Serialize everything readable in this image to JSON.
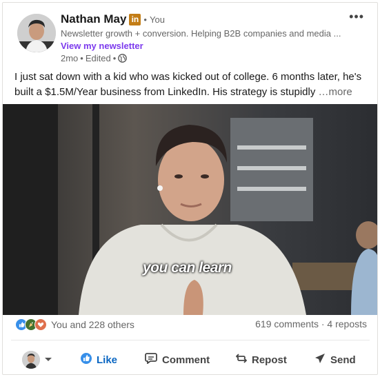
{
  "author": {
    "name": "Nathan May",
    "badge": "in",
    "separator": "•",
    "relation": "You",
    "headline": "Newsletter growth + conversion. Helping B2B companies and media ...",
    "newsletter_link": "View my newsletter",
    "time": "2mo",
    "edited": "Edited",
    "visibility_icon": "globe-icon"
  },
  "post": {
    "text": "I just sat down with a kid who was kicked out of college. 6 months later, he's built a $1.5M/Year business from LinkedIn. His strategy is stupidly ",
    "see_more": "…more"
  },
  "video": {
    "caption": "you can learn"
  },
  "social": {
    "reactions_text": "You and 228 others",
    "counts": "619 comments · 4 reposts",
    "reaction_icons": [
      "like-icon",
      "celebrate-icon",
      "love-icon"
    ]
  },
  "actions": {
    "like": "Like",
    "comment": "Comment",
    "repost": "Repost",
    "send": "Send"
  },
  "colors": {
    "accent": "#0a66c2",
    "newsletter": "#7c3aed",
    "badge": "#c37d16"
  }
}
